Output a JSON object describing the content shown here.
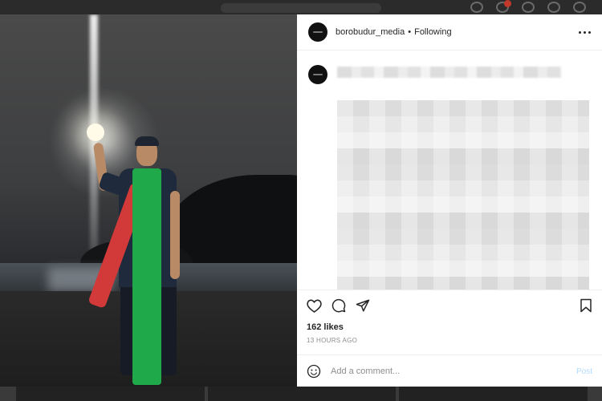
{
  "post": {
    "username": "borobudur_media",
    "separator": "•",
    "follow_status": "Following",
    "likes": "162 likes",
    "time_ago": "13 HOURS AGO"
  },
  "comment": {
    "placeholder": "Add a comment...",
    "post_label": "Post"
  },
  "icons": {
    "more": "more-options-icon",
    "like": "heart-icon",
    "comment": "comment-icon",
    "share": "send-icon",
    "save": "bookmark-icon",
    "emoji": "emoji-icon"
  },
  "colors": {
    "post_button": "#b3dbff",
    "meta_gray": "#8e8e8e",
    "text": "#262626"
  }
}
